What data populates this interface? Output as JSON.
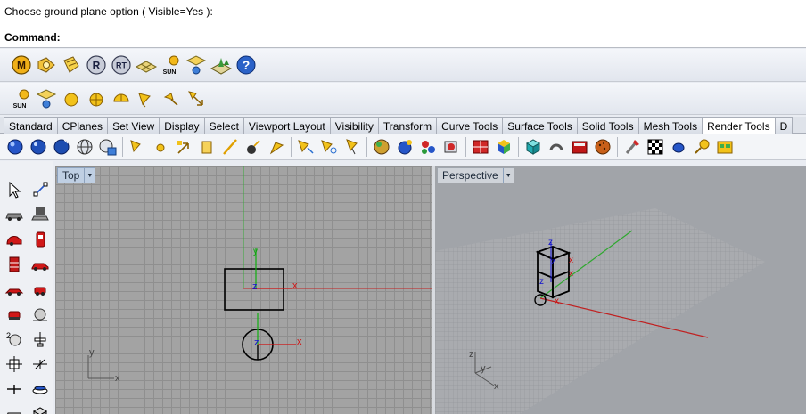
{
  "command": {
    "history_text": "Choose ground plane option ( Visible=Yes ):",
    "prompt_label": "Command:",
    "input_value": ""
  },
  "toolbar1": {
    "buttons": [
      {
        "name": "material-editor-icon",
        "glyph": "M"
      },
      {
        "name": "environment-editor-icon",
        "glyph": ""
      },
      {
        "name": "texture-icon",
        "glyph": ""
      },
      {
        "name": "render-icon",
        "glyph": "R"
      },
      {
        "name": "raytrace-icon",
        "glyph": "RT"
      },
      {
        "name": "ground-plane-icon",
        "glyph": ""
      },
      {
        "name": "sun-icon",
        "glyph": "SUN"
      },
      {
        "name": "spotlight-icon",
        "glyph": ""
      },
      {
        "name": "render-tools-icon",
        "glyph": ""
      },
      {
        "name": "help-icon",
        "glyph": "?"
      }
    ]
  },
  "toolbar2": {
    "sun_label": "SUN"
  },
  "tabs": [
    {
      "label": "Standard",
      "active": false
    },
    {
      "label": "CPlanes",
      "active": false
    },
    {
      "label": "Set View",
      "active": false
    },
    {
      "label": "Display",
      "active": false
    },
    {
      "label": "Select",
      "active": false
    },
    {
      "label": "Viewport Layout",
      "active": false
    },
    {
      "label": "Visibility",
      "active": false
    },
    {
      "label": "Transform",
      "active": false
    },
    {
      "label": "Curve Tools",
      "active": false
    },
    {
      "label": "Surface Tools",
      "active": false
    },
    {
      "label": "Solid Tools",
      "active": false
    },
    {
      "label": "Mesh Tools",
      "active": false
    },
    {
      "label": "Render Tools",
      "active": true
    },
    {
      "label": "D",
      "active": false
    }
  ],
  "viewports": {
    "top": {
      "title": "Top",
      "axis_x": "x",
      "axis_y": "y",
      "axis_z": "z"
    },
    "perspective": {
      "title": "Perspective",
      "axis_x": "x",
      "axis_y": "y",
      "axis_z": "z"
    }
  },
  "colors": {
    "x_axis": "#d01010",
    "y_axis": "#10b010",
    "z_axis": "#1010d0",
    "viewport_bg": "#a3a3a3",
    "active_viewport_title": "#bfcfe3"
  }
}
